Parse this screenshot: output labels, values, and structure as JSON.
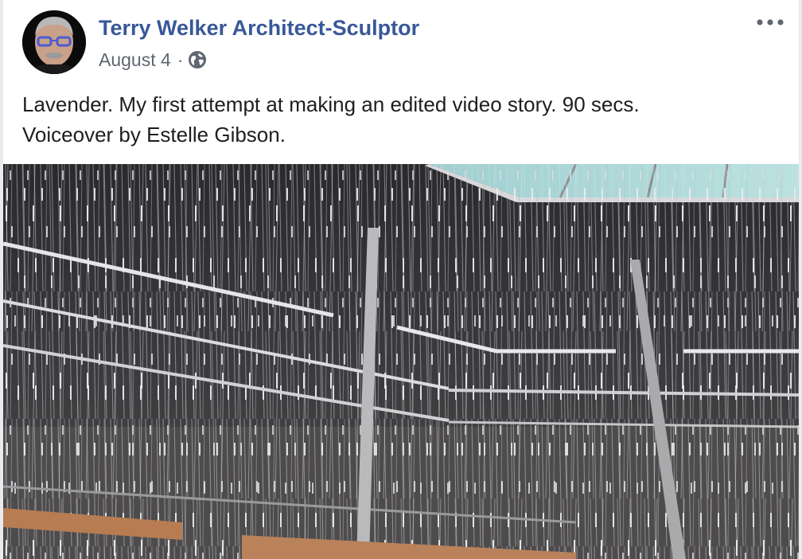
{
  "post": {
    "author": "Terry Welker Architect-Sculptor",
    "date": "August 4",
    "separator": "·",
    "privacy_icon": "globe-icon",
    "more_icon": "more-options-icon",
    "avatar_icon": "profile-photo",
    "caption_lines": [
      "Lavender. My first attempt at making an edited video story. 90 secs.",
      "Voiceover by Estelle Gibson."
    ],
    "media_kind": "video-thumbnail"
  },
  "colors": {
    "author_link": "#385898",
    "meta_text": "#616770",
    "body_text": "#1c1e21",
    "card_bg": "#ffffff",
    "page_bg": "#e9ebee"
  }
}
